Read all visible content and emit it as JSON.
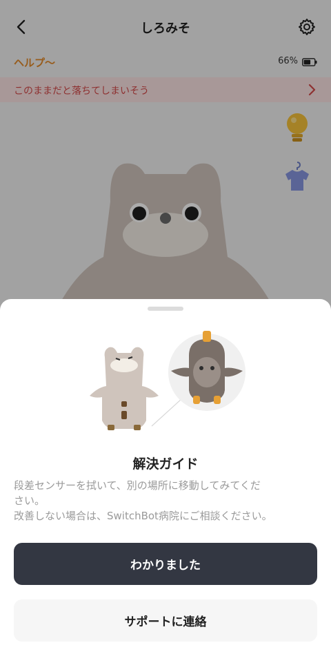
{
  "header": {
    "title": "しろみそ",
    "back_icon": "chevron-left-icon",
    "settings_icon": "gear-icon"
  },
  "status": {
    "help_label": "ヘルプ〜",
    "battery_percent": "66%",
    "battery_level": 0.66
  },
  "warning": {
    "text": "このままだと落ちてしまいそう",
    "color": "#d44a4a"
  },
  "side_icons": [
    "bulb-icon",
    "shirt-icon"
  ],
  "sheet": {
    "title": "解決ガイド",
    "body_lines": [
      "段差センサーを拭いて、別の場所に移動してみてくだ",
      "さい。",
      "改善しない場合は、SwitchBot病院にご相談ください。"
    ],
    "primary_button": "わかりました",
    "secondary_button": "サポートに連絡"
  },
  "colors": {
    "accent_orange": "#e28a2a",
    "primary_button_bg": "#333742",
    "warning_bg": "#fbe3e3"
  }
}
